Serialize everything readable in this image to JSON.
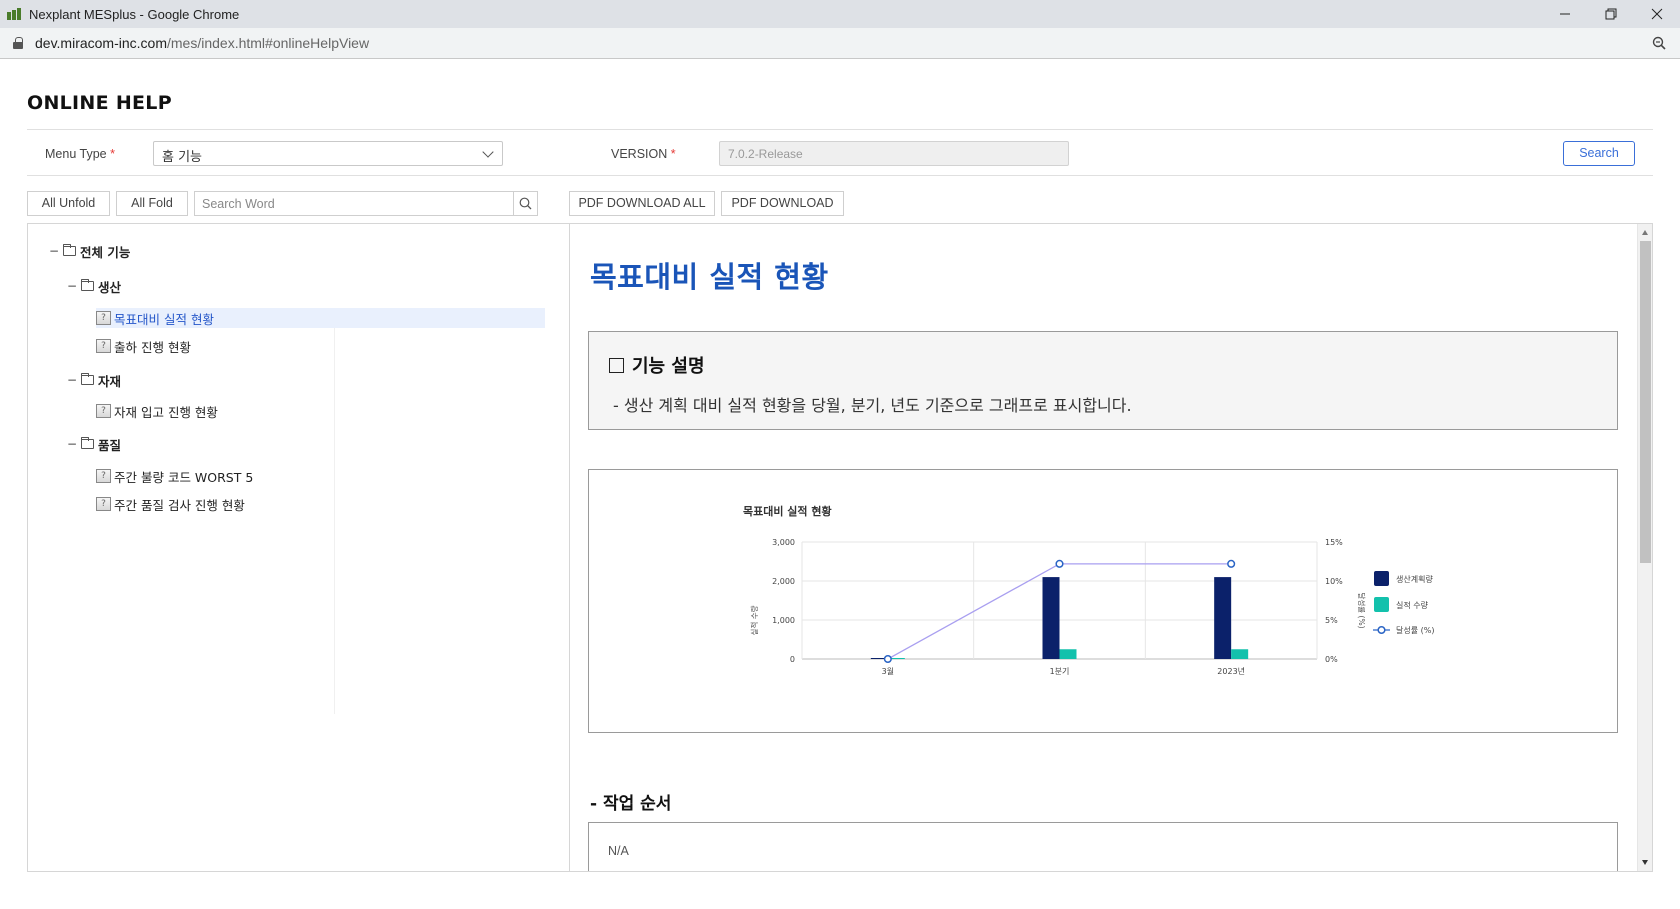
{
  "browser": {
    "window_title": "Nexplant MESplus - Google Chrome",
    "url_host": "dev.miracom-inc.com",
    "url_path": "/mes/index.html#onlineHelpView"
  },
  "page": {
    "title": "ONLINE HELP"
  },
  "filters": {
    "menu_type_label": "Menu Type",
    "menu_type_value": "홈 기능",
    "version_label": "VERSION",
    "version_value": "7.0.2-Release",
    "required_mark": "*",
    "search_button": "Search"
  },
  "toolbar": {
    "all_unfold": "All Unfold",
    "all_fold": "All Fold",
    "search_placeholder": "Search Word",
    "pdf_download_all": "PDF DOWNLOAD ALL",
    "pdf_download": "PDF DOWNLOAD"
  },
  "tree": {
    "toggle_glyph": "−",
    "doc_glyph": "?",
    "root": {
      "label": "전체 기능"
    },
    "groups": [
      {
        "label": "생산",
        "items": [
          {
            "label": "목표대비 실적 현황",
            "selected": true
          },
          {
            "label": "출하 진행 현황"
          }
        ]
      },
      {
        "label": "자재",
        "items": [
          {
            "label": "자재 입고 진행 현황"
          }
        ]
      },
      {
        "label": "품질",
        "items": [
          {
            "label": "주간 불량 코드 WORST 5"
          },
          {
            "label": "주간 품질 검사 진행 현황"
          }
        ]
      }
    ]
  },
  "content": {
    "title": "목표대비 실적 현황",
    "description_heading": "기능 설명",
    "description_text": "- 생산 계획 대비 실적 현황을 당월, 분기, 년도 기준으로 그래프로 표시합니다.",
    "steps_heading": "- 작업 순서",
    "steps_text": "N/A"
  },
  "colors": {
    "accent_blue": "#1a55b8",
    "plan_bar": "#0b216a",
    "actual_bar": "#13c1ac",
    "rate_line": "#a99ff0",
    "rate_marker": "#2a64c5"
  },
  "chart_data": {
    "type": "bar",
    "title": "목표대비 실적 현황",
    "categories": [
      "3월",
      "1분기",
      "2023년"
    ],
    "series": [
      {
        "name": "생산계획량",
        "type": "bar",
        "axis": "left",
        "values": [
          0,
          2100,
          2100
        ]
      },
      {
        "name": "실적 수량",
        "type": "bar",
        "axis": "left",
        "values": [
          0,
          250,
          250
        ]
      },
      {
        "name": "달성률 (%)",
        "type": "line",
        "axis": "right",
        "values": [
          0,
          12.2,
          12.2
        ]
      }
    ],
    "ylabel": "실적 수량",
    "y2label": "달성률 (%)",
    "ylim": [
      0,
      3000
    ],
    "yticks": [
      "0",
      "1,000",
      "2,000",
      "3,000"
    ],
    "y2lim": [
      0,
      15
    ],
    "y2ticks": [
      "0%",
      "5%",
      "10%",
      "15%"
    ],
    "grid": true,
    "legend_position": "right"
  }
}
